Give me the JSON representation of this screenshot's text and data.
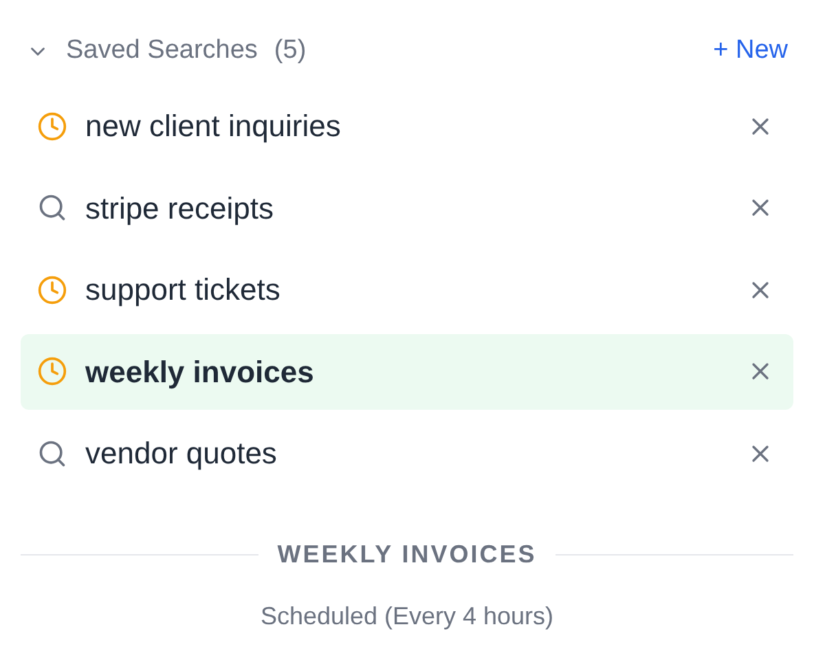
{
  "header": {
    "title": "Saved Searches",
    "count": "(5)",
    "expanded": true,
    "new_label": "+ New"
  },
  "searches": [
    {
      "label": "new client inquiries",
      "kind": "scheduled",
      "selected": false
    },
    {
      "label": "stripe receipts",
      "kind": "search",
      "selected": false
    },
    {
      "label": "support tickets",
      "kind": "scheduled",
      "selected": false
    },
    {
      "label": "weekly invoices",
      "kind": "scheduled",
      "selected": true
    },
    {
      "label": "vendor quotes",
      "kind": "search",
      "selected": false
    }
  ],
  "detail": {
    "title": "WEEKLY INVOICES",
    "schedule": "Scheduled (Every 4 hours)"
  }
}
